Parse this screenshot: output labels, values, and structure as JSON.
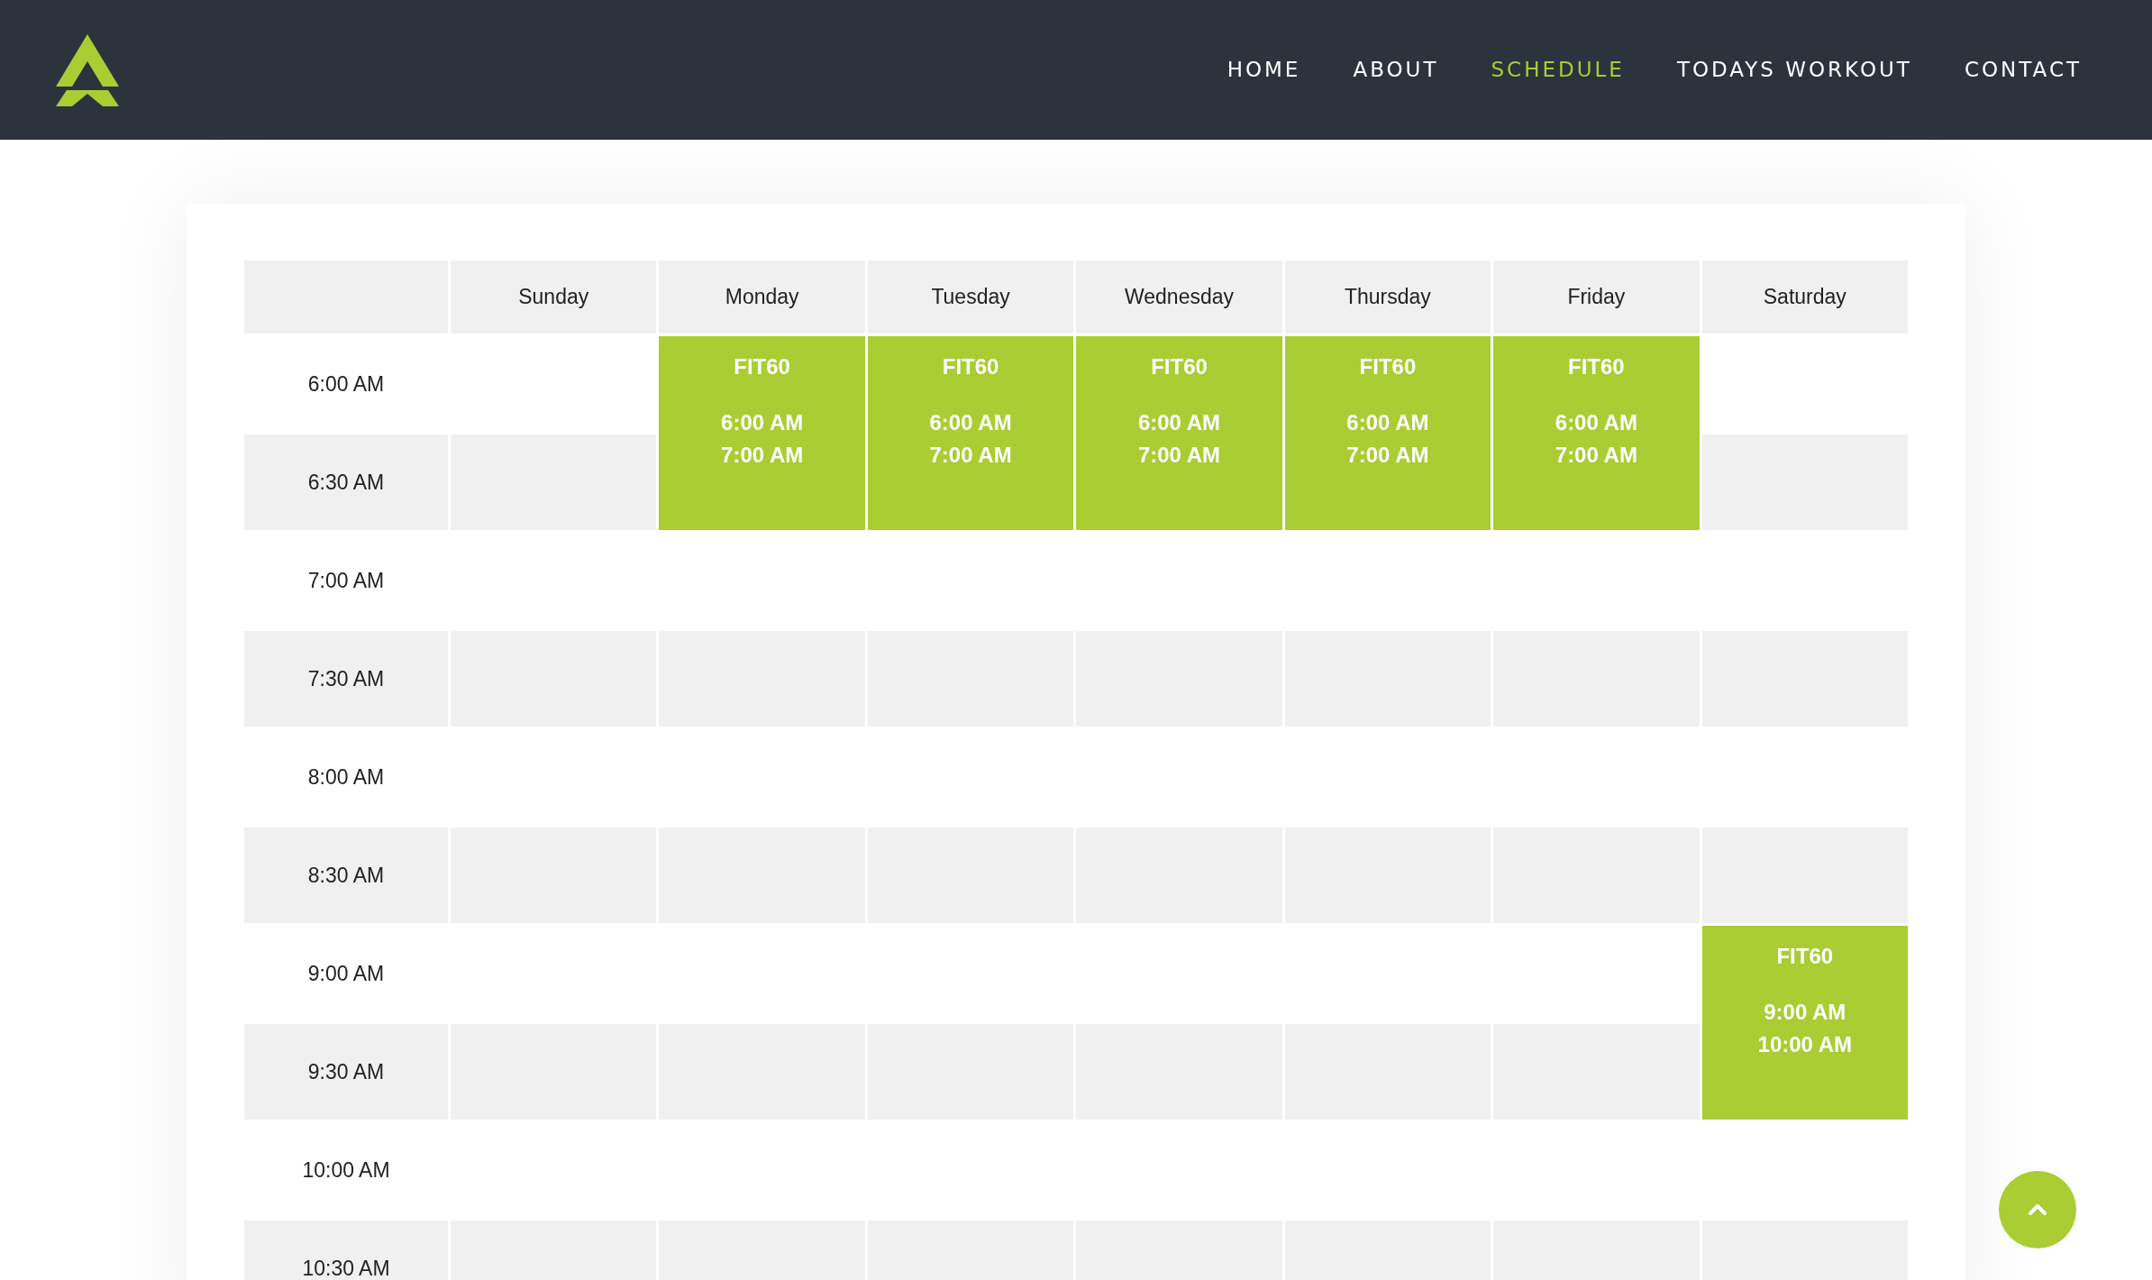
{
  "nav": {
    "items": [
      {
        "label": "HOME",
        "selected": false
      },
      {
        "label": "ABOUT",
        "selected": false
      },
      {
        "label": "SCHEDULE",
        "selected": true
      },
      {
        "label": "TODAYS WORKOUT",
        "selected": false
      },
      {
        "label": "CONTACT",
        "selected": false
      }
    ]
  },
  "schedule": {
    "days": [
      "Sunday",
      "Monday",
      "Tuesday",
      "Wednesday",
      "Thursday",
      "Friday",
      "Saturday"
    ],
    "rows": [
      {
        "time": "6:00 AM",
        "cells": [
          {
            "kind": "empty"
          },
          {
            "kind": "event",
            "title": "FIT60",
            "start": "6:00 AM",
            "end": "7:00 AM"
          },
          {
            "kind": "event",
            "title": "FIT60",
            "start": "6:00 AM",
            "end": "7:00 AM"
          },
          {
            "kind": "event",
            "title": "FIT60",
            "start": "6:00 AM",
            "end": "7:00 AM"
          },
          {
            "kind": "event",
            "title": "FIT60",
            "start": "6:00 AM",
            "end": "7:00 AM"
          },
          {
            "kind": "event",
            "title": "FIT60",
            "start": "6:00 AM",
            "end": "7:00 AM"
          },
          {
            "kind": "empty"
          }
        ]
      },
      {
        "time": "6:30 AM",
        "cells": [
          {
            "kind": "empty"
          },
          {
            "kind": "continued"
          },
          {
            "kind": "continued"
          },
          {
            "kind": "continued"
          },
          {
            "kind": "continued"
          },
          {
            "kind": "continued"
          },
          {
            "kind": "empty"
          }
        ]
      },
      {
        "time": "7:00 AM",
        "cells": [
          {
            "kind": "empty"
          },
          {
            "kind": "empty"
          },
          {
            "kind": "empty"
          },
          {
            "kind": "empty"
          },
          {
            "kind": "empty"
          },
          {
            "kind": "empty"
          },
          {
            "kind": "empty"
          }
        ]
      },
      {
        "time": "7:30 AM",
        "cells": [
          {
            "kind": "empty"
          },
          {
            "kind": "empty"
          },
          {
            "kind": "empty"
          },
          {
            "kind": "empty"
          },
          {
            "kind": "empty"
          },
          {
            "kind": "empty"
          },
          {
            "kind": "empty"
          }
        ]
      },
      {
        "time": "8:00 AM",
        "cells": [
          {
            "kind": "empty"
          },
          {
            "kind": "empty"
          },
          {
            "kind": "empty"
          },
          {
            "kind": "empty"
          },
          {
            "kind": "empty"
          },
          {
            "kind": "empty"
          },
          {
            "kind": "empty"
          }
        ]
      },
      {
        "time": "8:30 AM",
        "cells": [
          {
            "kind": "empty"
          },
          {
            "kind": "empty"
          },
          {
            "kind": "empty"
          },
          {
            "kind": "empty"
          },
          {
            "kind": "empty"
          },
          {
            "kind": "empty"
          },
          {
            "kind": "empty"
          }
        ]
      },
      {
        "time": "9:00 AM",
        "cells": [
          {
            "kind": "empty"
          },
          {
            "kind": "empty"
          },
          {
            "kind": "empty"
          },
          {
            "kind": "empty"
          },
          {
            "kind": "empty"
          },
          {
            "kind": "empty"
          },
          {
            "kind": "event",
            "title": "FIT60",
            "start": "9:00 AM",
            "end": "10:00 AM"
          }
        ]
      },
      {
        "time": "9:30 AM",
        "cells": [
          {
            "kind": "empty"
          },
          {
            "kind": "empty"
          },
          {
            "kind": "empty"
          },
          {
            "kind": "empty"
          },
          {
            "kind": "empty"
          },
          {
            "kind": "empty"
          },
          {
            "kind": "continued"
          }
        ]
      },
      {
        "time": "10:00 AM",
        "cells": [
          {
            "kind": "empty"
          },
          {
            "kind": "empty"
          },
          {
            "kind": "empty"
          },
          {
            "kind": "empty"
          },
          {
            "kind": "empty"
          },
          {
            "kind": "empty"
          },
          {
            "kind": "empty"
          }
        ]
      },
      {
        "time": "10:30 AM",
        "cells": [
          {
            "kind": "empty"
          },
          {
            "kind": "empty"
          },
          {
            "kind": "empty"
          },
          {
            "kind": "empty"
          },
          {
            "kind": "empty"
          },
          {
            "kind": "empty"
          },
          {
            "kind": "empty"
          }
        ]
      }
    ]
  }
}
